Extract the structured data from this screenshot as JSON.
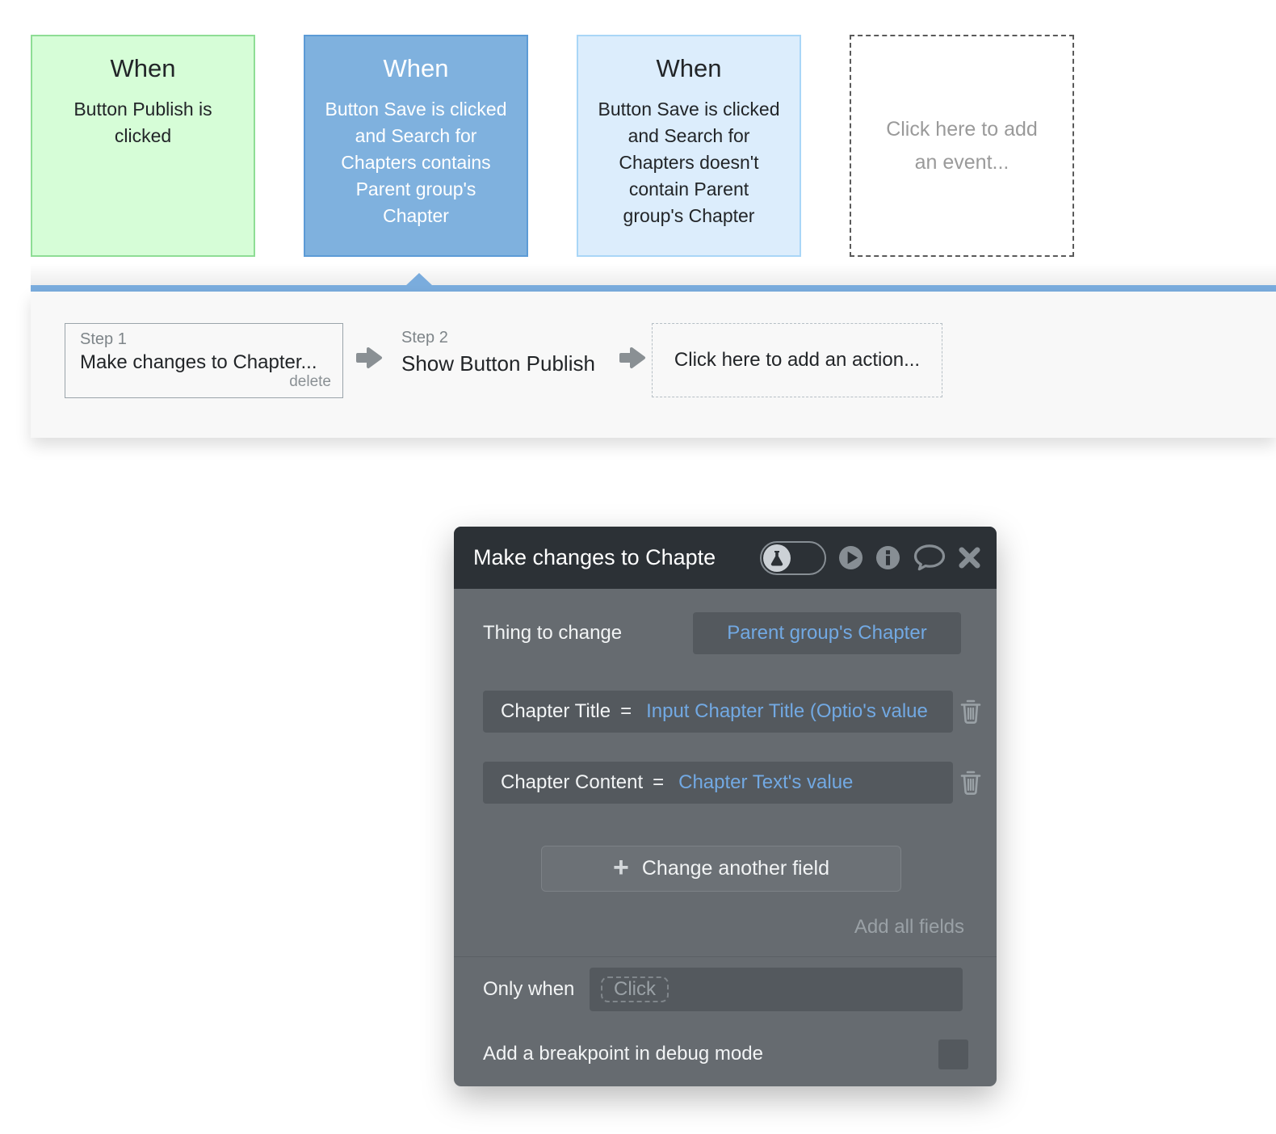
{
  "colors": {
    "accent-blue": "#7aacdd",
    "event-green-bg": "#d6fdd7",
    "event-green-border": "#8edd95",
    "event-blue-bg": "#7fb1de",
    "event-blue-border": "#5c9bd6",
    "event-lightblue-bg": "#dcedfc",
    "event-lightblue-border": "#a9d6f7",
    "bar-bg": "#f8f8f8",
    "modal-header-bg": "#2c3136",
    "modal-body-bg": "#666b70",
    "modal-box-bg": "#54595e",
    "modal-blue-text": "#72a9e3",
    "modal-icon-gray": "#878e94",
    "modal-muted-text": "#9aa1a6",
    "step-border": "#9aa4aa",
    "gray-text": "#7e8589",
    "dark-text": "#222528",
    "arrow-gray": "#8a9094"
  },
  "events": [
    {
      "title": "When",
      "description": "Button Publish is clicked"
    },
    {
      "title": "When",
      "description": "Button Save is clicked and Search for Chapters contains Parent group's Chapter"
    },
    {
      "title": "When",
      "description": "Button Save is clicked and Search for Chapters doesn't contain Parent group's Chapter"
    },
    {
      "placeholder": "Click here to add an event..."
    }
  ],
  "action_bar": {
    "steps": [
      {
        "label": "Step 1",
        "title": "Make changes to Chapter...",
        "delete_label": "delete"
      },
      {
        "label": "Step 2",
        "title": "Show Button Publish"
      }
    ],
    "add_action_placeholder": "Click here to add an action..."
  },
  "modal": {
    "title": "Make changes to Chapte",
    "thing_to_change": {
      "label": "Thing to change",
      "value": "Parent group's Chapter"
    },
    "field_rows": [
      {
        "label": "Chapter Title",
        "op": "=",
        "value": "Input Chapter Title (Optio's value"
      },
      {
        "label": "Chapter Content",
        "op": "=",
        "value": "Chapter Text's value"
      }
    ],
    "plus_glyph": "+",
    "change_another_field_label": "Change another field",
    "add_all_fields_label": "Add all fields",
    "only_when": {
      "label": "Only when",
      "placeholder": "Click"
    },
    "breakpoint_label": "Add a breakpoint in debug mode"
  }
}
